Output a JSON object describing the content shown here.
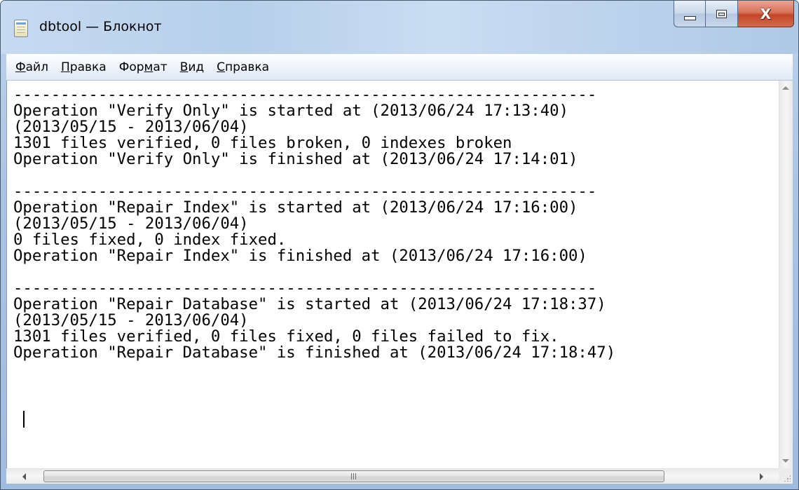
{
  "window": {
    "title": "dbtool — Блокнот",
    "close_glyph": "X",
    "app_icon": "notepad-icon"
  },
  "menu": {
    "items": [
      {
        "accel": "Ф",
        "rest": "айл",
        "label": "Файл"
      },
      {
        "accel": "П",
        "rest": "равка",
        "label": "Правка"
      },
      {
        "pre": "Фор",
        "accel": "м",
        "rest": "ат",
        "label": "Формат"
      },
      {
        "accel": "В",
        "rest": "ид",
        "label": "Вид"
      },
      {
        "accel": "С",
        "rest": "правка",
        "label": "Справка"
      }
    ]
  },
  "document": {
    "text": "--------------------------------------------------------------\nOperation \"Verify Only\" is started at (2013/06/24 17:13:40)\n(2013/05/15 - 2013/06/04)\n1301 files verified, 0 files broken, 0 indexes broken\nOperation \"Verify Only\" is finished at (2013/06/24 17:14:01)\n\n--------------------------------------------------------------\nOperation \"Repair Index\" is started at (2013/06/24 17:16:00)\n(2013/05/15 - 2013/06/04)\n0 files fixed, 0 index fixed.\nOperation \"Repair Index\" is finished at (2013/06/24 17:16:00)\n\n--------------------------------------------------------------\nOperation \"Repair Database\" is started at (2013/06/24 17:18:37)\n(2013/05/15 - 2013/06/04)\n1301 files verified, 0 files fixed, 0 files failed to fix.\nOperation \"Repair Database\" is finished at (2013/06/24 17:18:47)"
  },
  "scrollbars": {
    "horizontal_grip": "III"
  },
  "colors": {
    "close_button": "#c3462a",
    "frame": "#a9c4e3"
  }
}
